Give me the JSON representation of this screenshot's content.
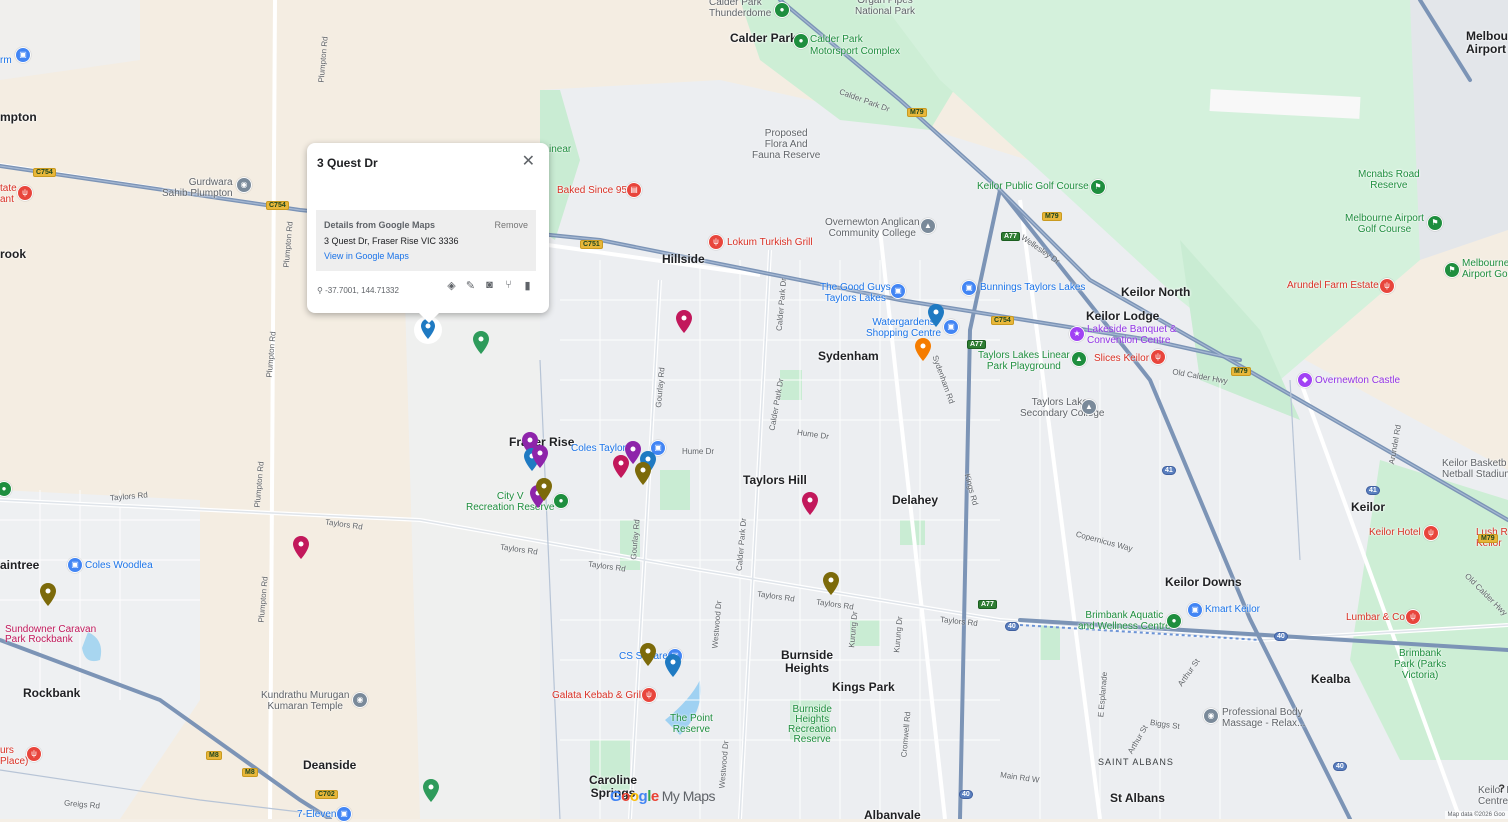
{
  "popup": {
    "title": "3 Quest Dr",
    "details_header": "Details from Google Maps",
    "remove_label": "Remove",
    "address": "3 Quest Dr, Fraser Rise VIC 3336",
    "link_label": "View in Google Maps",
    "coords": "-37.7001, 144.71332",
    "tools": [
      "paint-bucket-icon",
      "pencil-icon",
      "camera-icon",
      "directions-icon",
      "trash-icon"
    ]
  },
  "towns": {
    "calder_park": "Calder Park",
    "hillside": "Hillside",
    "sydenham": "Sydenham",
    "taylors_hill": "Taylors Hill",
    "delahey": "Delahey",
    "keilor_north": "Keilor North",
    "keilor_lodge": "Keilor Lodge",
    "keilor": "Keilor",
    "keilor_downs": "Keilor Downs",
    "burnside": "Burnside\nHeights",
    "kings_park": "Kings Park",
    "kealba": "Kealba",
    "rockbank": "Rockbank",
    "deanside": "Deanside",
    "caroline": "Caroline\nSprings",
    "albanvale": "Albanvale",
    "st_albans": "St Albans",
    "saint_albans": "SAINT ALBANS",
    "fraser_rise": "Fraser Rise",
    "melbourne_airport": "Melbourn\nAirport",
    "plumpton_partial": "mpton",
    "rook_partial": "rook",
    "aintree_partial": "aintree",
    "rm_partial": "rm"
  },
  "pois": {
    "thunderdome": "Calder Park\nThunderdome",
    "organ_pipes": "Organ Pipes\nNational Park",
    "motorsport": "Calder Park\nMotorsport Complex",
    "flora_fauna": "Proposed\nFlora And\nFauna Reserve",
    "linear": "inear",
    "baked": "Baked Since 95",
    "gurdwara": "Gurdwara\nSahib Plumpton",
    "lokum": "Lokum Turkish Grill",
    "anglican": "Overnewton Anglican\nCommunity College",
    "goodguys": "The Good Guys\nTaylors Lakes",
    "bunnings": "Bunnings Taylors Lakes",
    "watergardens": "Watergardens\nShopping Centre",
    "keilor_golf": "Keilor Public Golf Course",
    "mcnabs": "Mcnabs Road\nReserve",
    "airport_golf": "Melbourne Airport\nGolf Course",
    "airport_golf2": "Melbourne\nAirport Gol",
    "arundel": "Arundel Farm Estate",
    "lakeside": "Lakeside Banquet &\nConvention Centre",
    "slices": "Slices Keilor",
    "linear_park": "Taylors Lakes Linear\nPark Playground",
    "overnewton_castle": "Overnewton Castle",
    "secondary": "Taylors Lakes\nSecondary College",
    "coles_taylor": "Coles Taylor",
    "city_vista": "City V\nRecreation Reserve",
    "coles_woodlea": "Coles Woodlea",
    "sundowner": "Sundowner Caravan\nPark Rockbank",
    "kundrathu": "Kundrathu Murugan\nKumaran Temple",
    "cs_square": "CS Square",
    "galata": "Galata Kebab & Grill",
    "point_reserve": "The Point\nReserve",
    "burnside_rr": "Burnside\nHeights\nRecreation\nReserve",
    "brimbank_aquatic": "Brimbank Aquatic\nand Wellness Centre",
    "kmart": "Kmart Keilor",
    "lumbar": "Lumbar & Co",
    "keilor_hotel": "Keilor Hotel",
    "lush": "Lush R\nKeilor",
    "basketball": "Keilor Basketb\nNetball Stadium",
    "brimbank_park": "Brimbank\nPark (Parks\nVictoria)",
    "body_massage": "Professional Body\nMassage - Relax...",
    "keilor_east": "Keilor Eas\nCentre",
    "seven_eleven": "7-Eleven",
    "urs_place": "urs\nPlace)",
    "tate": "tate\nant"
  },
  "roads": {
    "plumpton_rd": "Plumpton Rd",
    "calder_park_dr": "Calder Park Dr",
    "taylors_rd": "Taylors Rd",
    "hume_dr": "Hume Dr",
    "gourlay_rd": "Gourlay Rd",
    "calder_park_dr2": "Calder Park Dr",
    "sydenham_rd": "Sydenham Rd",
    "kings_rd": "Kings Rd",
    "wellesley": "Wellesley Dr",
    "old_calder": "Old Calder Hwy",
    "arundel_rd": "Arundel Rd",
    "copernicus": "Copernicus Way",
    "westwood": "Westwood Dr",
    "kurung": "Kurung Dr",
    "cromwell": "Cromwell Rd",
    "e_esplanade": "E Esplanade",
    "main_rd": "Main Rd W",
    "biggs": "Biggs St",
    "arthur": "Arthur St",
    "greigs": "Greigs Rd",
    "old_calder2": "Old Calder Hwy"
  },
  "shields": {
    "m79": "M79",
    "c754": "C754",
    "c751": "C751",
    "a77": "A77",
    "c754b": "C754",
    "m8": "M8",
    "m80": "M80",
    "c702": "C702",
    "r40": "40",
    "r41": "41"
  },
  "brand": {
    "g1": "G",
    "g2": "o",
    "g3": "o",
    "g4": "g",
    "g5": "l",
    "g6": "e",
    "my_maps": "My Maps"
  },
  "attribution": "Map data ©2026 Goo",
  "help": "?",
  "colors": {
    "land": "#f5efe6",
    "urban": "#eef0f2",
    "park": "#c9ecd3",
    "highway": "#7c94b6",
    "marker_blue": "#1f7ac2",
    "marker_magenta": "#c2185b",
    "marker_purple": "#8e24aa",
    "marker_olive": "#7c6a0a",
    "marker_green": "#2e9b5b"
  }
}
